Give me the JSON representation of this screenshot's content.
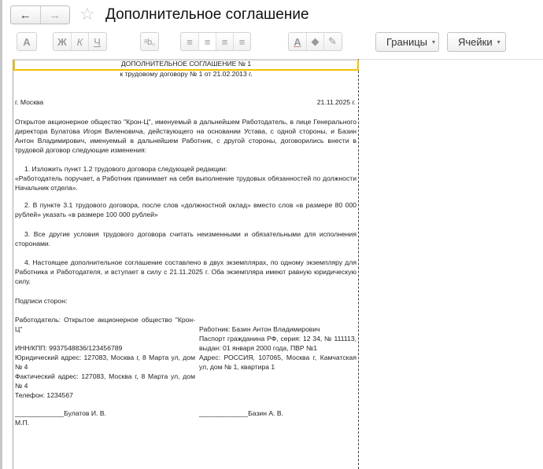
{
  "window": {
    "title": "Дополнительное соглашение",
    "back_icon": "←",
    "forward_icon": "→",
    "star_icon": "☆"
  },
  "toolbar": {
    "font": "A",
    "bold": "Ж",
    "italic": "К",
    "underline": "Ч",
    "spell": "ᵃb꜀",
    "align": [
      "≡",
      "≡",
      "≡",
      "≡"
    ],
    "text_color": "A",
    "fill": "◆",
    "pen": "✎",
    "borders": "Границы",
    "cells": "Ячейки",
    "dropdown_icon": "▾"
  },
  "document": {
    "heading": "ДОПОЛНИТЕЛЬНОЕ СОГЛАШЕНИЕ № 1",
    "subheading": "к трудовому договору № 1 от 21.02.2013 г.",
    "city": "г. Москва",
    "date": "21.11.2025 г.",
    "intro": "Открытое акционерное общество \"Крон-Ц\", именуемый в дальнейшем Работодатель, в лице Генерального директора Булатова Игоря Виленовича, действующего на основании Устава, с одной стороны, и Базин Антон Владимирович, именуемый в дальнейшем Работник, с другой стороны, договорились внести в трудовой договор следующие изменения:",
    "item1_title": "1. Изложить пункт 1.2 трудового договора следующей редакции:",
    "item1_body": "«Работодатель поручает, а Работник принимает на себя выполнение трудовых обязанностей по должности Начальник отдела».",
    "item2": "2. В пункте 3.1 трудового договора, после слов «должностной оклад» вместо слов «в размере 80 000 рублей» указать «в размере 100 000 рублей»",
    "item3": "3. Все другие условия трудового договора считать неизменными и обязательными для исполнения сторонами.",
    "item4": "4. Настоящее дополнительное соглашение составлено в двух экземплярах, по одному экземпляру для Работника и Работодателя, и вступает в силу с 21.11.2025 г. Оба экземпляра имеют равную юридическую силу.",
    "signatures_label": "Подписи сторон:",
    "employer": {
      "name": "Работодатель: Открытое акционерное общество \"Крон-Ц\"",
      "inn": "ИНН/КПП: 9937548836/123456789",
      "legal_address": "Юридический адрес: 127083, Москва г, 8 Марта ул, дом № 4",
      "actual_address": "Фактический адрес: 127083, Москва г, 8 Марта ул, дом № 4",
      "phone": "Телефон: 1234567",
      "signature": "_____________Булатов И. В.",
      "stamp": "М.П."
    },
    "employee": {
      "name": "Работник: Базин Антон Владимирович",
      "passport": "Паспорт гражданина РФ, серия: 12 34, № 111113, выдан: 01 января 2000 года, ПВР №1",
      "address": "Адрес: РОССИЯ, 107065, Москва г, Камчатская ул, дом № 1, квартира 1",
      "signature": "_____________Базин А. В."
    }
  }
}
